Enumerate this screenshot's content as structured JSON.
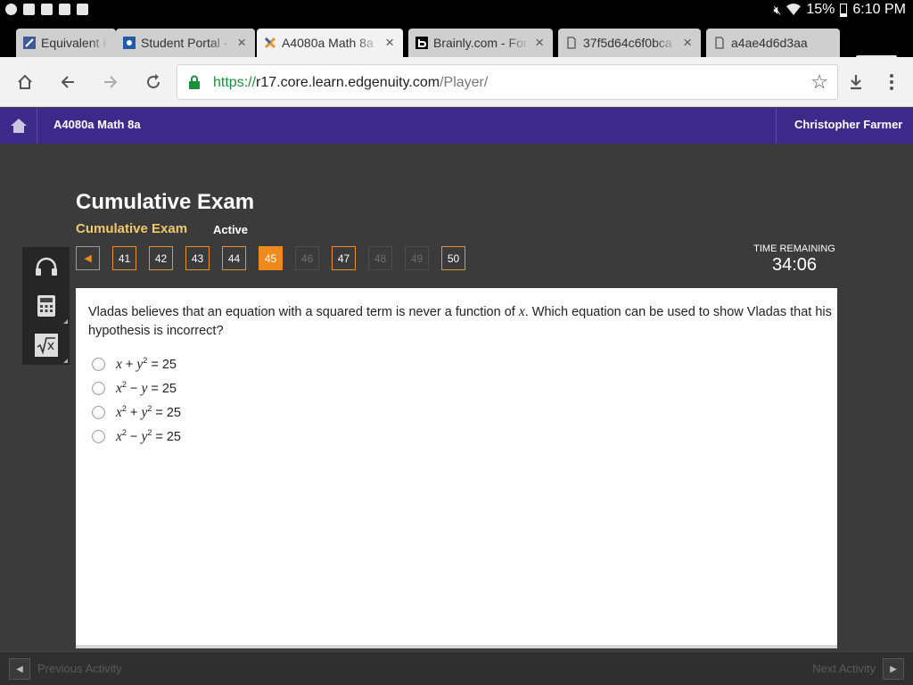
{
  "status_bar": {
    "battery": "15%",
    "time": "6:10 PM"
  },
  "tabs": [
    {
      "title": "Equivalent Ex",
      "close": "×",
      "active": false
    },
    {
      "title": "Student Portal - S",
      "close": "×",
      "active": false
    },
    {
      "title": "A4080a Math 8a",
      "close": "×",
      "active": true
    },
    {
      "title": "Brainly.com - For",
      "close": "×",
      "active": false
    },
    {
      "title": "37f5d64c6f0bca",
      "close": "×",
      "active": false
    },
    {
      "title": "a4ae4d6d3aa",
      "close": "",
      "active": false
    }
  ],
  "address_bar": {
    "scheme": "https://",
    "host": "r17.core.learn.edgenuity.com",
    "path": "/Player/"
  },
  "header": {
    "course": "A4080a Math 8a",
    "user": "Christopher Farmer"
  },
  "exam": {
    "title": "Cumulative Exam",
    "subtitle": "Cumulative Exam",
    "status": "Active"
  },
  "question_nav": {
    "prev_glyph": "◀",
    "items": [
      {
        "num": "41",
        "state": "default"
      },
      {
        "num": "42",
        "state": "default"
      },
      {
        "num": "43",
        "state": "default"
      },
      {
        "num": "44",
        "state": "default"
      },
      {
        "num": "45",
        "state": "current"
      },
      {
        "num": "46",
        "state": "disabled"
      },
      {
        "num": "47",
        "state": "default"
      },
      {
        "num": "48",
        "state": "disabled"
      },
      {
        "num": "49",
        "state": "disabled"
      },
      {
        "num": "50",
        "state": "default"
      }
    ]
  },
  "timer": {
    "label": "TIME REMAINING",
    "value": "34:06"
  },
  "tools": [
    "headphones-icon",
    "calculator-icon",
    "formula-sheet-icon"
  ],
  "question": {
    "text_before": "Vladas believes that an equation with a squared term is never a function of ",
    "variable": "x",
    "text_after": ". Which equation can be used to show Vladas that his hypothesis is incorrect?",
    "options": [
      {
        "a": "x",
        "a_exp": "",
        "op": " + ",
        "b": "y",
        "b_exp": "2",
        "rhs": " = 25"
      },
      {
        "a": "x",
        "a_exp": "2",
        "op": " − ",
        "b": "y",
        "b_exp": "",
        "rhs": " = 25"
      },
      {
        "a": "x",
        "a_exp": "2",
        "op": " + ",
        "b": "y",
        "b_exp": "2",
        "rhs": " = 25"
      },
      {
        "a": "x",
        "a_exp": "2",
        "op": " − ",
        "b": "y",
        "b_exp": "2",
        "rhs": " = 25"
      }
    ]
  },
  "footer": {
    "prev_label": "Previous Activity",
    "next_label": "Next Activity",
    "prev_glyph": "◀",
    "next_glyph": "▶"
  },
  "colors": {
    "header_bg": "#3c2a8b",
    "accent_orange": "#f08a1c",
    "subtitle_gold": "#f1c86b",
    "page_bg": "#3b3b3b"
  }
}
